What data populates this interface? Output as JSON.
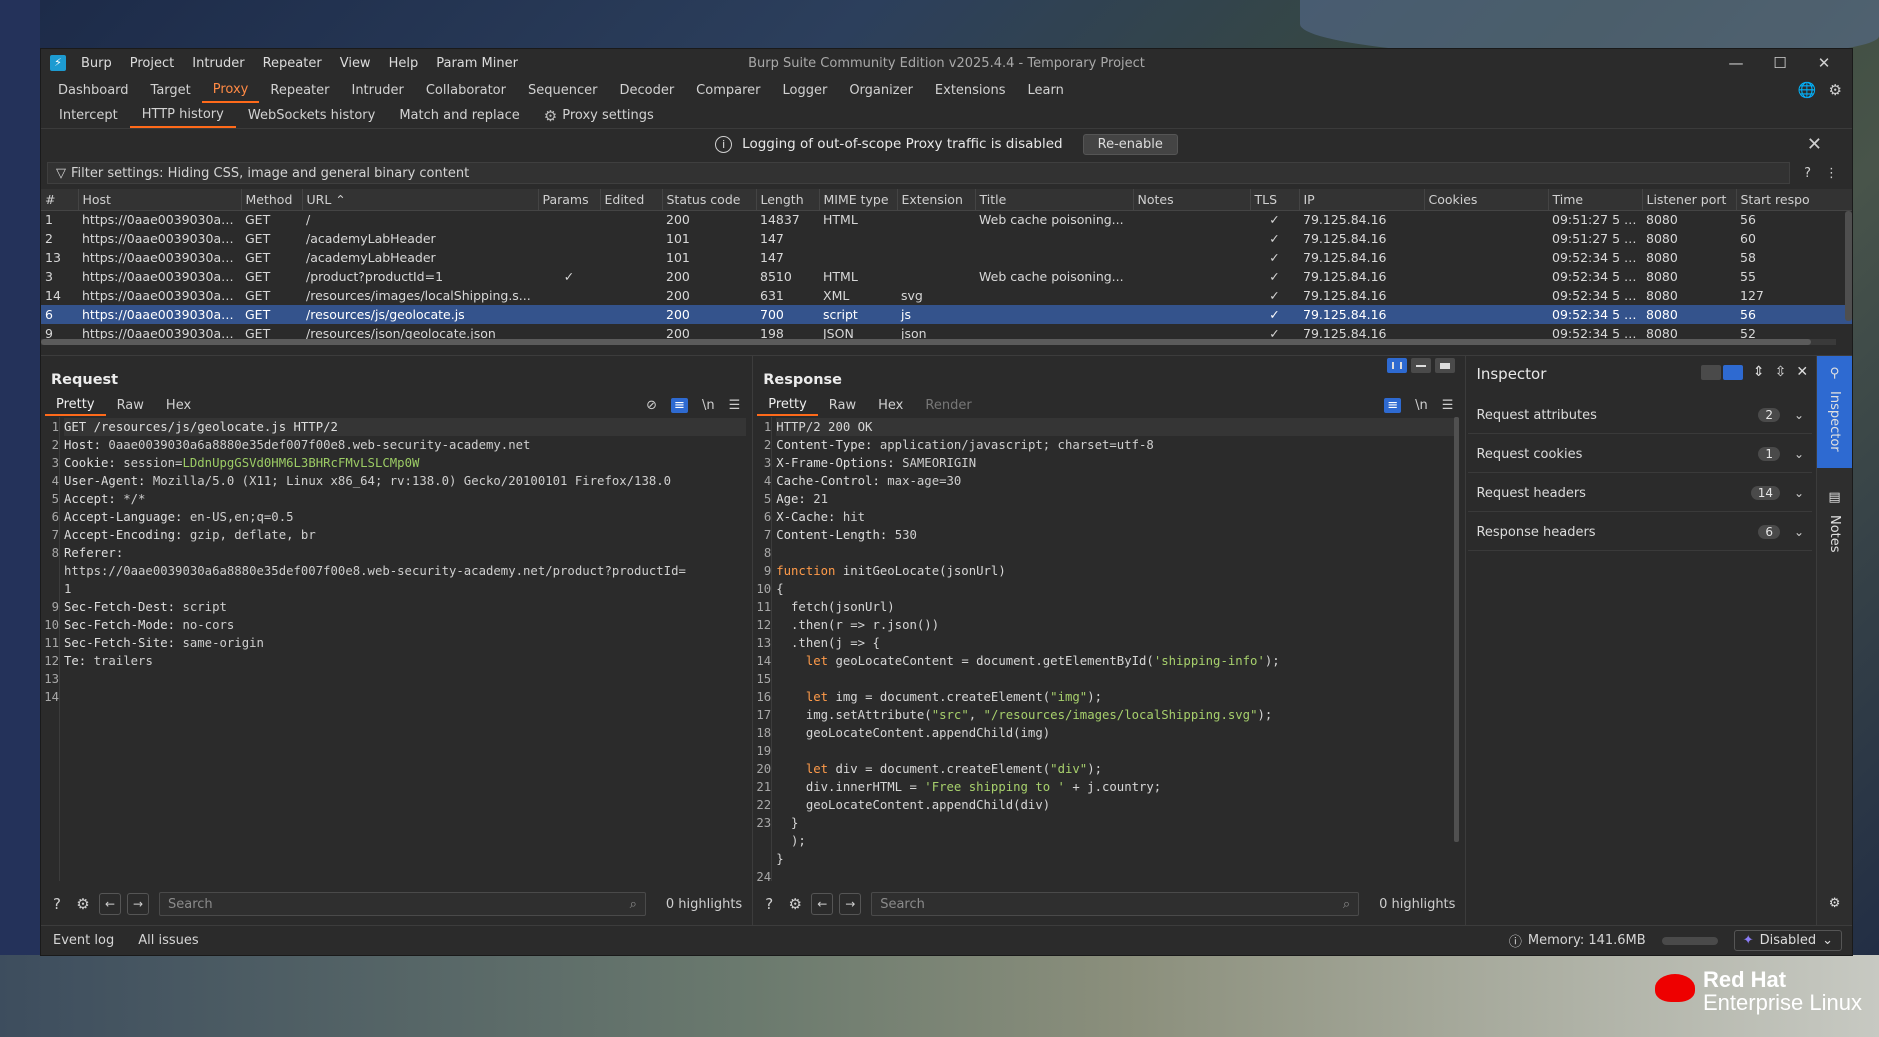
{
  "window": {
    "title": "Burp Suite Community Edition v2025.4.4 - Temporary Project",
    "menu": [
      "Burp",
      "Project",
      "Intruder",
      "Repeater",
      "View",
      "Help",
      "Param Miner"
    ]
  },
  "main_tabs": [
    "Dashboard",
    "Target",
    "Proxy",
    "Repeater",
    "Intruder",
    "Collaborator",
    "Sequencer",
    "Decoder",
    "Comparer",
    "Logger",
    "Organizer",
    "Extensions",
    "Learn"
  ],
  "proxy_tabs": [
    "Intercept",
    "HTTP history",
    "WebSockets history",
    "Match and replace",
    "Proxy settings"
  ],
  "notice": {
    "message": "Logging of out-of-scope Proxy traffic is disabled",
    "button": "Re-enable"
  },
  "filter": {
    "text": "Filter settings: Hiding CSS, image and general binary content"
  },
  "history": {
    "columns": [
      "#",
      "Host",
      "Method",
      "URL",
      "Params",
      "Edited",
      "Status code",
      "Length",
      "MIME type",
      "Extension",
      "Title",
      "Notes",
      "TLS",
      "IP",
      "Cookies",
      "Time",
      "Listener port",
      "Start respo"
    ],
    "rows": [
      [
        "1",
        "https://0aae0039030a6a888...",
        "GET",
        "/",
        "",
        "",
        "200",
        "14837",
        "HTML",
        "",
        "Web cache poisoning...",
        "",
        "✓",
        "79.125.84.16",
        "",
        "09:51:27 5 J...",
        "8080",
        "56"
      ],
      [
        "2",
        "https://0aae0039030a6a888...",
        "GET",
        "/academyLabHeader",
        "",
        "",
        "101",
        "147",
        "",
        "",
        "",
        "",
        "✓",
        "79.125.84.16",
        "",
        "09:51:27 5 J...",
        "8080",
        "60"
      ],
      [
        "13",
        "https://0aae0039030a6a888...",
        "GET",
        "/academyLabHeader",
        "",
        "",
        "101",
        "147",
        "",
        "",
        "",
        "",
        "✓",
        "79.125.84.16",
        "",
        "09:52:34 5 J...",
        "8080",
        "58"
      ],
      [
        "3",
        "https://0aae0039030a6a888...",
        "GET",
        "/product?productId=1",
        "✓",
        "",
        "200",
        "8510",
        "HTML",
        "",
        "Web cache poisoning...",
        "",
        "✓",
        "79.125.84.16",
        "",
        "09:52:34 5 J...",
        "8080",
        "55"
      ],
      [
        "14",
        "https://0aae0039030a6a888...",
        "GET",
        "/resources/images/localShipping.s...",
        "",
        "",
        "200",
        "631",
        "XML",
        "svg",
        "",
        "",
        "✓",
        "79.125.84.16",
        "",
        "09:52:34 5 J...",
        "8080",
        "127"
      ],
      [
        "6",
        "https://0aae0039030a6a888...",
        "GET",
        "/resources/js/geolocate.js",
        "",
        "",
        "200",
        "700",
        "script",
        "js",
        "",
        "",
        "✓",
        "79.125.84.16",
        "",
        "09:52:34 5 J...",
        "8080",
        "56"
      ],
      [
        "9",
        "https://0aae0039030a6a888...",
        "GET",
        "/resources/json/geolocate.json",
        "",
        "",
        "200",
        "198",
        "JSON",
        "json",
        "",
        "",
        "✓",
        "79.125.84.16",
        "",
        "09:52:34 5 J...",
        "8080",
        "52"
      ]
    ]
  },
  "request": {
    "title": "Request",
    "tabs": [
      "Pretty",
      "Raw",
      "Hex"
    ],
    "toggle_label": "\\n",
    "line_numbers": [
      "1",
      "2",
      "3",
      "4",
      "5",
      "6",
      "7",
      "8",
      "",
      "",
      "9",
      "10",
      "11",
      "12",
      "13",
      "14"
    ],
    "lines": [
      {
        "k": "GET /resources/js/geolocate.js HTTP/2",
        "v": ""
      },
      {
        "k": "Host: ",
        "v": "0aae0039030a6a8880e35def007f00e8.web-security-academy.net"
      },
      {
        "k": "Cookie: ",
        "v": "session=",
        "c": "LDdnUpgGSVd0HM6L3BHRcFMvLSLCMp0W"
      },
      {
        "k": "User-Agent: ",
        "v": "Mozilla/5.0 (X11; Linux x86_64; rv:138.0) Gecko/20100101 Firefox/138.0"
      },
      {
        "k": "Accept: ",
        "v": "*/*"
      },
      {
        "k": "Accept-Language: ",
        "v": "en-US,en;q=0.5"
      },
      {
        "k": "Accept-Encoding: ",
        "v": "gzip, deflate, br"
      },
      {
        "k": "Referer:",
        "v": ""
      },
      {
        "k": "",
        "v": "https://0aae0039030a6a8880e35def007f00e8.web-security-academy.net/product?productId="
      },
      {
        "k": "",
        "v": "1"
      },
      {
        "k": "Sec-Fetch-Dest: ",
        "v": "script"
      },
      {
        "k": "Sec-Fetch-Mode: ",
        "v": "no-cors"
      },
      {
        "k": "Sec-Fetch-Site: ",
        "v": "same-origin"
      },
      {
        "k": "Te: ",
        "v": "trailers"
      },
      {
        "k": "",
        "v": ""
      },
      {
        "k": "",
        "v": ""
      }
    ],
    "search_placeholder": "Search",
    "highlights": "0 highlights"
  },
  "response": {
    "title": "Response",
    "tabs": [
      "Pretty",
      "Raw",
      "Hex",
      "Render"
    ],
    "toggle_label": "\\n",
    "line_numbers": [
      "1",
      "2",
      "3",
      "4",
      "5",
      "6",
      "7",
      "8",
      "9",
      "10",
      "11",
      "12",
      "13",
      "14",
      "15",
      "16",
      "17",
      "18",
      "19",
      "20",
      "21",
      "22",
      "23",
      "",
      "",
      "24"
    ],
    "lines": [
      "HTTP/2 200 OK",
      "Content-Type: application/javascript; charset=utf-8",
      "X-Frame-Options: SAMEORIGIN",
      "Cache-Control: max-age=30",
      "Age: 21",
      "X-Cache: hit",
      "Content-Length: 530",
      "",
      "function initGeoLocate(jsonUrl)",
      "{",
      "  fetch(jsonUrl)",
      "  .then(r => r.json())",
      "  .then(j => {",
      "    let geoLocateContent = document.getElementById('shipping-info');",
      "",
      "    let img = document.createElement(\"img\");",
      "    img.setAttribute(\"src\", \"/resources/images/localShipping.svg\");",
      "    geoLocateContent.appendChild(img)",
      "",
      "    let div = document.createElement(\"div\");",
      "    div.innerHTML = 'Free shipping to ' + j.country;",
      "    geoLocateContent.appendChild(div)",
      "  }",
      "  );",
      "}",
      ""
    ],
    "search_placeholder": "Search",
    "highlights": "0 highlights"
  },
  "inspector": {
    "title": "Inspector",
    "rows": [
      {
        "label": "Request attributes",
        "count": "2"
      },
      {
        "label": "Request cookies",
        "count": "1"
      },
      {
        "label": "Request headers",
        "count": "14"
      },
      {
        "label": "Response headers",
        "count": "6"
      }
    ]
  },
  "sidebar": {
    "tabs": [
      "Inspector",
      "Notes"
    ]
  },
  "statusbar": {
    "event_log": "Event log",
    "all_issues": "All issues",
    "memory": "Memory: 141.6MB",
    "ai": "Disabled"
  },
  "desktop": {
    "brand_line1": "Red Hat",
    "brand_line2": "Enterprise Linux"
  }
}
